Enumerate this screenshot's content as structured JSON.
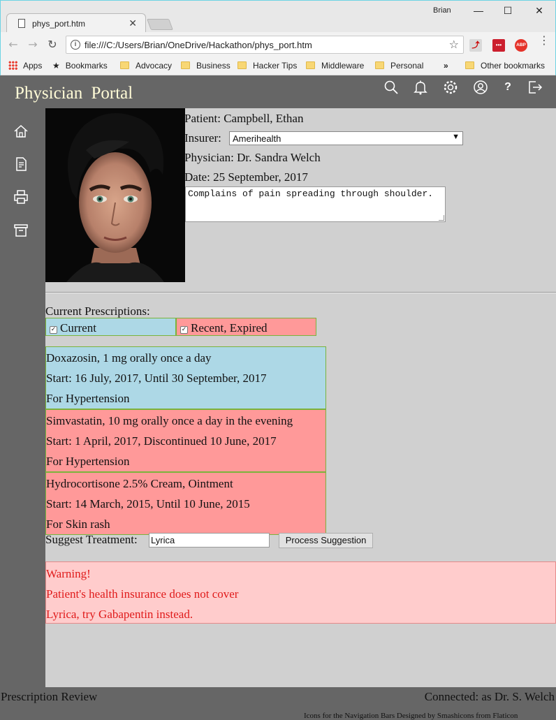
{
  "browser": {
    "tab_title": "phys_port.htm",
    "window_user": "Brian",
    "url": "file:///C:/Users/Brian/OneDrive/Hackathon/phys_port.htm",
    "bookmarks": [
      "Apps",
      "Bookmarks",
      "Advocacy",
      "Business",
      "Hacker Tips",
      "Middleware",
      "Personal"
    ],
    "overflow": "»",
    "other_bookmarks": "Other bookmarks",
    "extensions": {
      "abp": "ABP",
      "lastpass": "•••"
    }
  },
  "app": {
    "title": "Physician  Portal",
    "top_icons": [
      "search-icon",
      "bell-icon",
      "settings-icon",
      "user-icon",
      "help-icon",
      "logout-icon"
    ],
    "side_icons": [
      "home-icon",
      "document-icon",
      "print-icon",
      "archive-icon"
    ],
    "help_glyph": "?"
  },
  "patient": {
    "name_line": "Patient: Campbell, Ethan",
    "insurer_label": "Insurer:",
    "insurer_value": "Amerihealth",
    "physician_line": "Physician: Dr. Sandra Welch",
    "date_line": "Date: 25 September, 2017",
    "notes": "Complains of pain spreading through shoulder."
  },
  "prescriptions": {
    "heading": "Current Prescriptions:",
    "filters": [
      {
        "label": "Current",
        "checked": true,
        "color": "#add8e6"
      },
      {
        "label": "Recent, Expired",
        "checked": true,
        "color": "#ff9999"
      }
    ],
    "items": [
      {
        "drug": "Doxazosin, 1 mg orally once a day",
        "dates": "Start: 16 July, 2017, Until 30 September, 2017",
        "reason": "For Hypertension",
        "status": "current",
        "color": "#add8e6"
      },
      {
        "drug": "Simvastatin, 10 mg orally once a day in the evening",
        "dates": "Start: 1 April, 2017, Discontinued 10 June, 2017",
        "reason": "For Hypertension",
        "status": "expired",
        "color": "#ff9999"
      },
      {
        "drug": "Hydrocortisone 2.5% Cream, Ointment",
        "dates": "Start: 14 March, 2015, Until 10 June, 2015",
        "reason": "For Skin rash",
        "status": "expired",
        "color": "#ff9999"
      }
    ]
  },
  "suggest": {
    "label": "Suggest Treatment:",
    "value": "Lyrica",
    "button": "Process Suggestion"
  },
  "warning": {
    "lines": [
      "Warning!",
      "Patient's health insurance does not cover",
      "Lyrica, try Gabapentin instead."
    ]
  },
  "footer": {
    "left": "Prescription Review",
    "right": "Connected: as Dr. S. Welch",
    "credit": "Icons for the Navigation Bars Designed by Smashicons from Flaticon"
  }
}
